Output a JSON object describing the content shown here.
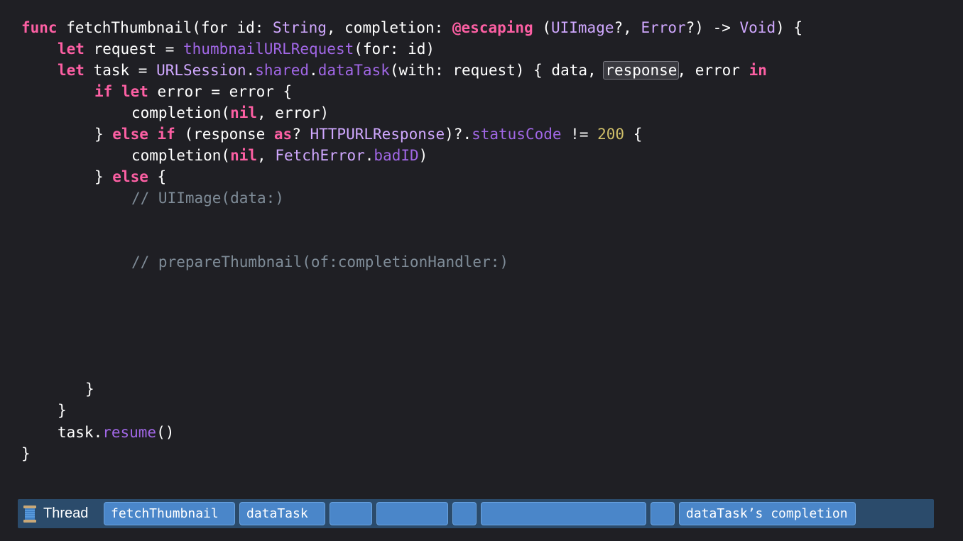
{
  "code": {
    "line1": {
      "t1": "func",
      "t2": " fetchThumbnail(for id: ",
      "t3": "String",
      "t4": ", completion: ",
      "t5": "@escaping",
      "t6": " (",
      "t7": "UIImage",
      "t8": "?, ",
      "t9": "Error",
      "t10": "?) -> ",
      "t11": "Void",
      "t12": ") {"
    },
    "line2": {
      "t1": "let",
      "t2": " request = ",
      "t3": "thumbnailURLRequest",
      "t4": "(for: id)"
    },
    "line3": {
      "t1": "let",
      "t2": " task = ",
      "t3": "URLSession",
      "t4": ".",
      "t5": "shared",
      "t6": ".",
      "t7": "dataTask",
      "t8": "(with: request) { data, ",
      "t9": "response",
      "t10": ", error ",
      "t11": "in"
    },
    "line4": {
      "t1": "if",
      "t2": " ",
      "t3": "let",
      "t4": " error = error {"
    },
    "line5": {
      "t1": "completion(",
      "t2": "nil",
      "t3": ", error)"
    },
    "line6": {
      "t1": "} ",
      "t2": "else",
      "t3": " ",
      "t4": "if",
      "t5": " (response ",
      "t6": "as",
      "t7": "? ",
      "t8": "HTTPURLResponse",
      "t9": ")?.",
      "t10": "statusCode",
      "t11": " != ",
      "t12": "200",
      "t13": " {"
    },
    "line7": {
      "t1": "completion(",
      "t2": "nil",
      "t3": ", ",
      "t4": "FetchError",
      "t5": ".",
      "t6": "badID",
      "t7": ")"
    },
    "line8": {
      "t1": "} ",
      "t2": "else",
      "t3": " {"
    },
    "line9": "// UIImage(data:)",
    "line10": "// prepareThumbnail(of:completionHandler:)",
    "line11": "}",
    "line12": "}",
    "line13": {
      "t1": "task.",
      "t2": "resume",
      "t3": "()"
    },
    "line14": "}"
  },
  "thread_bar": {
    "label": "Thread",
    "icon": "spool-of-thread-icon",
    "segments": [
      "fetchThumbnail",
      "dataTask",
      "",
      "",
      "",
      "",
      "",
      "dataTask’s completion"
    ]
  },
  "colors": {
    "background": "#1f1f24",
    "keyword": "#fc5fa3",
    "type": "#d0a8ff",
    "function": "#a167e6",
    "number": "#d0bf69",
    "comment": "#7f8c98",
    "thread_bar": "#2b4b6b",
    "segment": "#4a86c9"
  }
}
